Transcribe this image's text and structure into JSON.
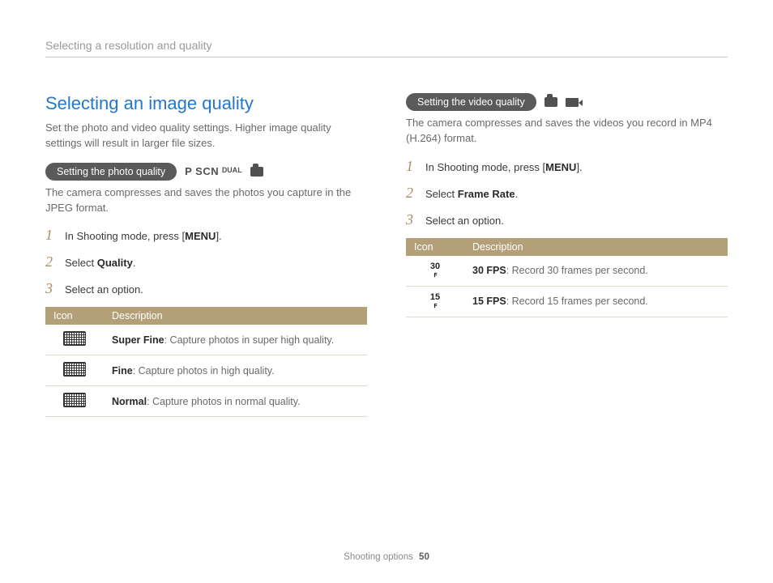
{
  "breadcrumb": "Selecting a resolution and quality",
  "left": {
    "heading": "Selecting an image quality",
    "intro": "Set the photo and video quality settings. Higher image quality settings will result in larger file sizes.",
    "pill": "Setting the photo quality",
    "modes": "P  SCN  ᴰᵁᴬᴸ",
    "after_pill": "The camera compresses and saves the photos you capture in the JPEG format.",
    "step1_a": "In Shooting mode, press [",
    "step1_b": "MENU",
    "step1_c": "].",
    "step2_a": "Select ",
    "step2_b": "Quality",
    "step2_c": ".",
    "step3": "Select an option.",
    "th_icon": "Icon",
    "th_desc": "Description",
    "rows": [
      {
        "icon": "quality-superfine-icon",
        "label": "Super Fine",
        "desc": ": Capture photos in super high quality."
      },
      {
        "icon": "quality-fine-icon",
        "label": "Fine",
        "desc": ": Capture photos in high quality."
      },
      {
        "icon": "quality-normal-icon",
        "label": "Normal",
        "desc": ": Capture photos in normal quality."
      }
    ]
  },
  "right": {
    "pill": "Setting the video quality",
    "after_pill": "The camera compresses and saves the videos you record in MP4 (H.264) format.",
    "step1_a": "In Shooting mode, press [",
    "step1_b": "MENU",
    "step1_c": "].",
    "step2_a": "Select ",
    "step2_b": "Frame Rate",
    "step2_c": ".",
    "step3": "Select an option.",
    "th_icon": "Icon",
    "th_desc": "Description",
    "rows": [
      {
        "icon_top": "30",
        "icon_sub": "ꜰ",
        "label": "30 FPS",
        "desc": ": Record 30 frames per second."
      },
      {
        "icon_top": "15",
        "icon_sub": "ꜰ",
        "label": "15 FPS",
        "desc": ": Record 15 frames per second."
      }
    ]
  },
  "footer": {
    "section": "Shooting options",
    "page": "50"
  }
}
